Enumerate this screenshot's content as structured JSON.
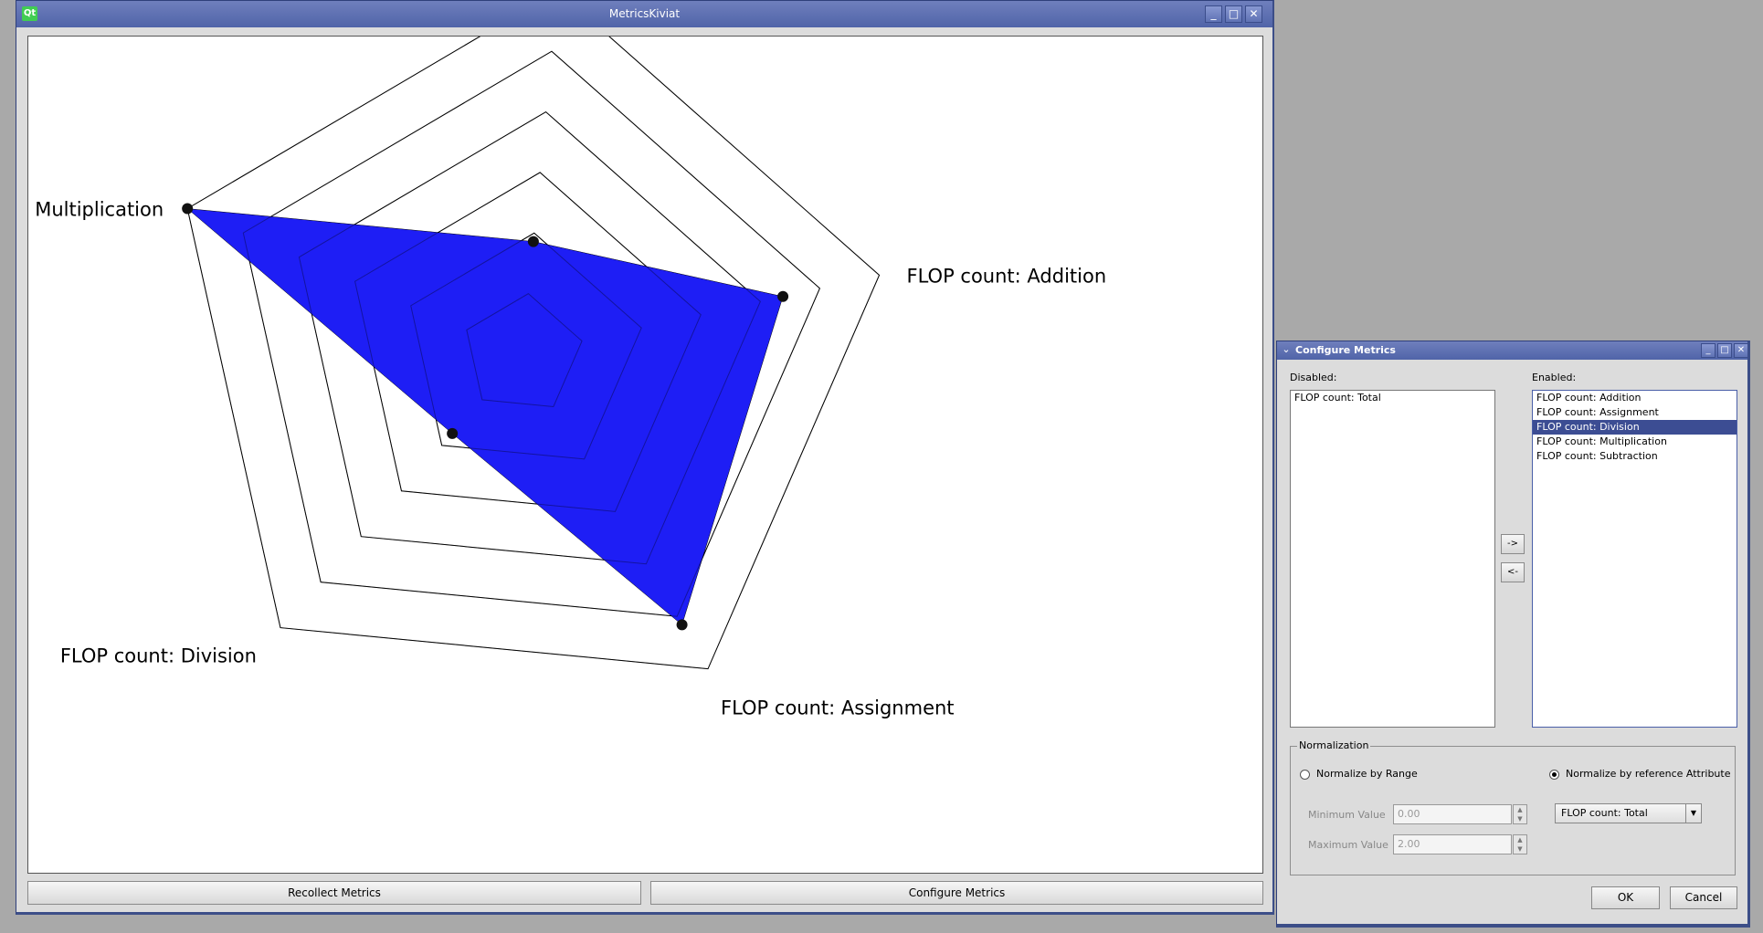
{
  "main_window": {
    "title": "MetricsKiviat",
    "logo_text": "Qt",
    "controls": {
      "minimize": "_",
      "maximize": "□",
      "close": "✕"
    },
    "buttons": {
      "recollect": "Recollect Metrics",
      "configure": "Configure Metrics"
    }
  },
  "chart_data": {
    "type": "radar",
    "axes": [
      "FLOP count: Addition",
      "FLOP count: Assignment",
      "FLOP count: Division",
      "FLOP count: Multiplication",
      "FLOP count: Subtraction"
    ],
    "rings": 6,
    "series": [
      {
        "values": [
          0.73,
          0.86,
          0.29,
          1.0,
          0.31
        ],
        "color": "#1e1ef5"
      }
    ]
  },
  "dialog": {
    "title": "Configure Metrics",
    "controls": {
      "menu": "⌄",
      "minimize": "_",
      "maximize": "□",
      "close": "✕"
    },
    "disabled_label": "Disabled:",
    "enabled_label": "Enabled:",
    "disabled_items": [
      "FLOP count: Total"
    ],
    "enabled_items": [
      "FLOP count: Addition",
      "FLOP count: Assignment",
      "FLOP count: Division",
      "FLOP count: Multiplication",
      "FLOP count: Subtraction"
    ],
    "selected_enabled_index": 2,
    "move_right": "->",
    "move_left": "<-",
    "normalization": {
      "title": "Normalization",
      "by_range": "Normalize by Range",
      "by_reference": "Normalize by reference Attribute",
      "selected": "by_reference",
      "min_label": "Minimum Value",
      "min_value": "0.00",
      "max_label": "Maximum Value",
      "max_value": "2.00",
      "reference_attribute": "FLOP count: Total"
    },
    "ok": "OK",
    "cancel": "Cancel"
  }
}
